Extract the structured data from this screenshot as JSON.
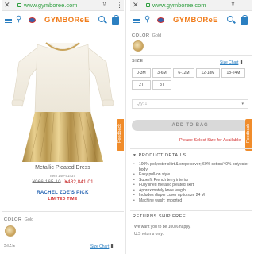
{
  "browser": {
    "url": "www.gymboree.com"
  },
  "header": {
    "logo": "GYMBOReE"
  },
  "product": {
    "name": "Metallic Pleated Dress",
    "item_number": "Item 140*91437",
    "old_price": "¥966,165.10",
    "new_price": "¥482,841.01",
    "promo_line1": "RACHEL ZOE'S PICK",
    "promo_line2": "LIMITED TIME"
  },
  "feedback_label": "Feedback",
  "color_section": {
    "label": "COLOR",
    "value": "Gold"
  },
  "size_section": {
    "label": "SIZE",
    "size_chart": "Size Chart",
    "options": [
      "0-3M",
      "3-6M",
      "6-12M",
      "12-18M",
      "18-24M",
      "2T",
      "3T"
    ]
  },
  "quantity": {
    "placeholder": "Qty: 1"
  },
  "add_to_bag": "ADD TO BAG",
  "select_size_msg": "Please Select Size for Available",
  "product_details": {
    "heading": "PRODUCT DETAILS",
    "bullets": [
      "100% polyester skirt & crepe cover; 60% cotton/40% polyester body",
      "Easy pull-on style",
      "Superfit French terry interior",
      "Fully lined metallic pleated skirt",
      "Approximately knee length",
      "Includes diaper cover up to size 24 M",
      "Machine wash; imported"
    ]
  },
  "returns": {
    "heading": "RETURNS SHIP FREE",
    "line1": "We want you to be 100% happy.",
    "line2": "U.S returns only."
  }
}
